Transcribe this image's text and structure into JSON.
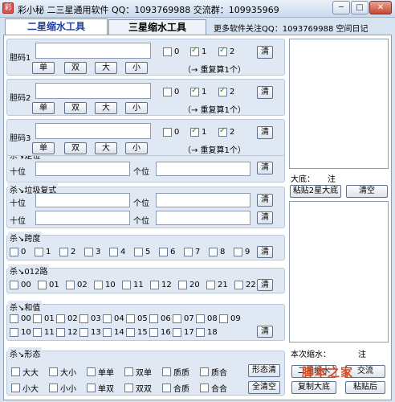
{
  "window": {
    "title": "彩小秘 二三星通用软件  QQ：1093769988  交流群：109935969",
    "min": "─",
    "max": "□",
    "close": "✕"
  },
  "tabs": {
    "active": "二星缩水工具",
    "other": "三星缩水工具"
  },
  "toplink": "更多软件关注QQ：1093769988 空间日记",
  "dan": {
    "rows": [
      {
        "label": "胆码1"
      },
      {
        "label": "胆码2"
      },
      {
        "label": "胆码3"
      }
    ],
    "btns": [
      "单",
      "双",
      "大",
      "小"
    ],
    "c0": "0",
    "c1": "1",
    "c2": "2",
    "note": "（→ 重复算1个）",
    "clear": "清"
  },
  "position": {
    "legend": "杀↘定位",
    "ten": "十位",
    "unit": "个位",
    "clear": "清"
  },
  "combo": {
    "legend": "杀↘垃圾复式",
    "ten": "十位",
    "unit": "个位",
    "clear": "清"
  },
  "span": {
    "legend": "杀↘跨度",
    "items": [
      "0",
      "1",
      "2",
      "3",
      "4",
      "5",
      "6",
      "7",
      "8",
      "9"
    ],
    "clear": "清"
  },
  "route": {
    "legend": "杀↘012路",
    "items": [
      "00",
      "01",
      "02",
      "10",
      "11",
      "12",
      "20",
      "21",
      "22"
    ],
    "clear": "清"
  },
  "sum": {
    "legend": "杀↘和值",
    "row1": [
      "00",
      "01",
      "02",
      "03",
      "04",
      "05",
      "06",
      "07",
      "08",
      "09"
    ],
    "row2": [
      "10",
      "11",
      "12",
      "13",
      "14",
      "15",
      "16",
      "17",
      "18"
    ],
    "clear": "清"
  },
  "form": {
    "legend": "杀↘形态",
    "row1": [
      "大大",
      "大小",
      "单单",
      "双单",
      "质质",
      "质合"
    ],
    "row2": [
      "小大",
      "小小",
      "单双",
      "双双",
      "合质",
      "合合"
    ],
    "clear": "形态清",
    "clearAll": "全清空"
  },
  "right": {
    "base_label": "大底：",
    "base_value": "注",
    "paste": "粘贴2星大底",
    "clear": "清空",
    "result_label": "本次缩水：",
    "result_value": "注",
    "shrink": "二星缩水",
    "exchange": "交流",
    "copy": "复制大底",
    "append": "粘贴后"
  },
  "watermark": "脚本之家"
}
